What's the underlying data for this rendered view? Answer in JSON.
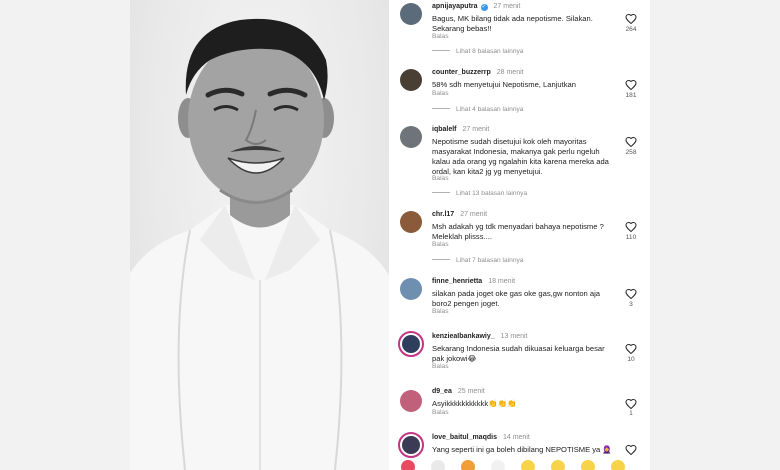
{
  "comments": [
    {
      "user": "apnijayaputra",
      "verified": true,
      "time": "27 menit",
      "text": "Bagus, MK bilang tidak ada nepotisme. Silakan. Sekarang bebas!!",
      "reply": "Balas",
      "more": "Lihat 8 balasan lainnya",
      "likes": "264",
      "avatar_color": "#5b6b7a"
    },
    {
      "user": "counter_buzzerrp",
      "verified": false,
      "time": "28 menit",
      "text": "58% sdh menyetujui Nepotisme, Lanjutkan",
      "reply": "Balas",
      "more": "Lihat 4 balasan lainnya",
      "likes": "181",
      "avatar_color": "#4a3f35"
    },
    {
      "user": "iqbalelf",
      "verified": false,
      "time": "27 menit",
      "text": "Nepotisme sudah disetujui kok oleh mayoritas masyarakat Indonesia, makanya gak perlu ngeluh kalau ada orang yg ngalahin kita karena mereka ada ordal, kan kita2 jg yg menyetujui.",
      "reply": "Balas",
      "more": "Lihat 13 balasan lainnya",
      "likes": "258",
      "avatar_color": "#6e7479"
    },
    {
      "user": "chr.l17",
      "verified": false,
      "time": "27 menit",
      "text": "Msh adakah yg tdk menyadari bahaya nepotisme ? Meleklah plisss....",
      "reply": "Balas",
      "more": "Lihat 7 balasan lainnya",
      "likes": "110",
      "avatar_color": "#8a5a3a"
    },
    {
      "user": "finne_henrietta",
      "verified": false,
      "time": "18 menit",
      "text": "silakan pada joget oke gas oke gas,gw nonton aja boro2 pengen joget.",
      "reply": "Balas",
      "more": "",
      "likes": "3",
      "avatar_color": "#6f8fb0"
    },
    {
      "user": "kenzieaIbankawiy_",
      "verified": false,
      "time": "13 menit",
      "text": "Sekarang Indonesia sudah dikuasai keluarga besar pak jokowi😂",
      "reply": "Balas",
      "more": "",
      "likes": "10",
      "avatar_color": "#2f3e5c"
    },
    {
      "user": "d9_ea",
      "verified": false,
      "time": "25 menit",
      "text": "Asyikkkkkkkkkkk👏👏👏",
      "reply": "Balas",
      "more": "",
      "likes": "1",
      "avatar_color": "#c0607a"
    },
    {
      "user": "love_baitul_maqdis",
      "verified": false,
      "time": "14 menit",
      "text": "Yang seperti ini ga boleh dibilang NEPOTISME ya 🧕",
      "reply": "",
      "more": "",
      "likes": "",
      "avatar_color": "#3b3b55"
    }
  ],
  "colors": {
    "like_icon": "#262626",
    "muted": "#8e8e8e",
    "story_ring": "#c13584"
  }
}
